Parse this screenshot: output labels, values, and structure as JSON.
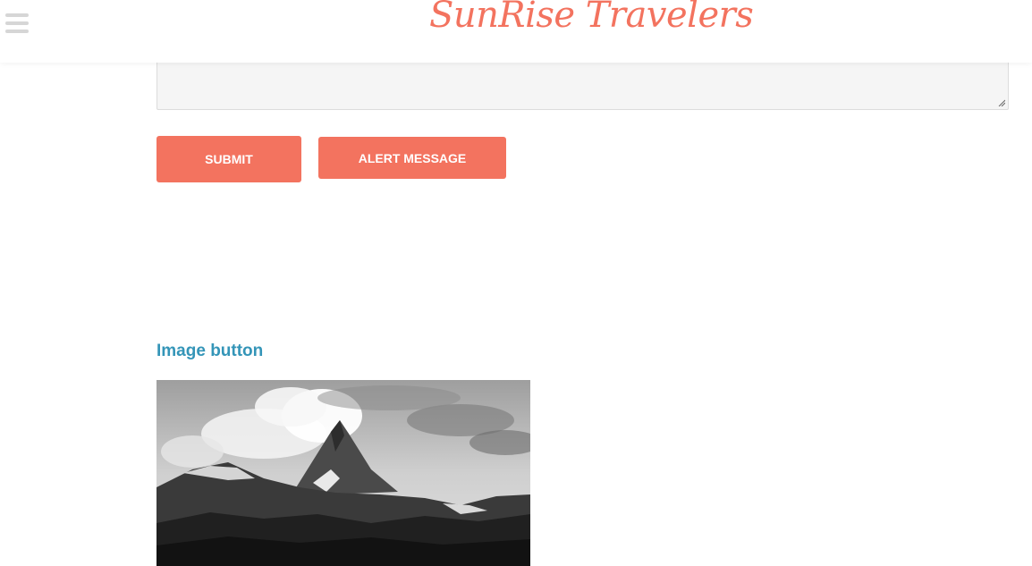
{
  "header": {
    "site_title": "SunRise Travelers",
    "menu_icon": "hamburger-menu-icon",
    "brand_color": "#f3735f"
  },
  "form": {
    "message_value": "",
    "submit_label": "SUBMIT",
    "alert_label": "ALERT MESSAGE",
    "button_color": "#f3735f"
  },
  "image_section": {
    "heading": "Image button",
    "heading_color": "#3495b8",
    "image_subject": "black-and-white mountain peak photo"
  }
}
